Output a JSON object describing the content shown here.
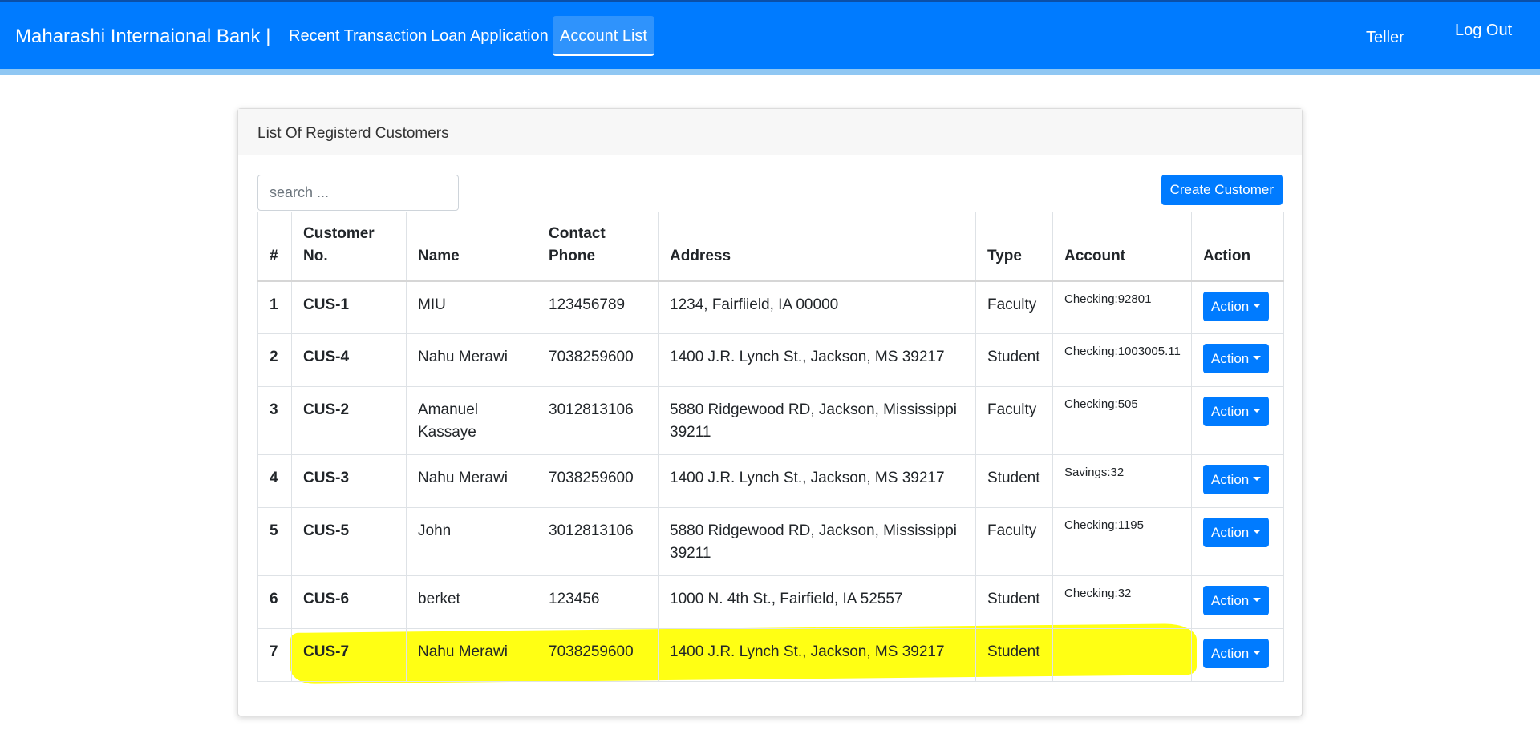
{
  "nav": {
    "brand": "Maharashi Internaional Bank |",
    "links": [
      "Recent Transaction",
      "Loan Application",
      "Account List"
    ],
    "role": "Teller",
    "logout": "Log Out"
  },
  "card": {
    "title": "List Of Registerd Customers",
    "search_placeholder": "search ...",
    "create_label": "Create Customer"
  },
  "table": {
    "headers": {
      "num": "#",
      "customer_no_1": "Customer",
      "customer_no_2": "No.",
      "name": "Name",
      "phone_1": "Contact",
      "phone_2": "Phone",
      "address": "Address",
      "type": "Type",
      "account": "Account",
      "action": "Action"
    },
    "rows": [
      {
        "num": "1",
        "id": "CUS-1",
        "name": "MIU",
        "phone": "123456789",
        "address": "1234, Fairfiield, IA 00000",
        "type": "Faculty",
        "account": "Checking:92801",
        "action": "Action"
      },
      {
        "num": "2",
        "id": "CUS-4",
        "name": "Nahu Merawi",
        "phone": "7038259600",
        "address": "1400 J.R. Lynch St., Jackson, MS 39217",
        "type": "Student",
        "account": "Checking:1003005.11",
        "action": "Action"
      },
      {
        "num": "3",
        "id": "CUS-2",
        "name": "Amanuel Kassaye",
        "phone": "3012813106",
        "address": "5880 Ridgewood RD, Jackson, Mississippi 39211",
        "type": "Faculty",
        "account": "Checking:505",
        "action": "Action"
      },
      {
        "num": "4",
        "id": "CUS-3",
        "name": "Nahu Merawi",
        "phone": "7038259600",
        "address": "1400 J.R. Lynch St., Jackson, MS 39217",
        "type": "Student",
        "account": "Savings:32",
        "action": "Action"
      },
      {
        "num": "5",
        "id": "CUS-5",
        "name": "John",
        "phone": "3012813106",
        "address": "5880 Ridgewood RD, Jackson, Mississippi 39211",
        "type": "Faculty",
        "account": "Checking:1195",
        "action": "Action"
      },
      {
        "num": "6",
        "id": "CUS-6",
        "name": "berket",
        "phone": "123456",
        "address": "1000 N. 4th St., Fairfield, IA 52557",
        "type": "Student",
        "account": "Checking:32",
        "action": "Action"
      },
      {
        "num": "7",
        "id": "CUS-7",
        "name": "Nahu Merawi",
        "phone": "7038259600",
        "address": "1400 J.R. Lynch St., Jackson, MS 39217",
        "type": "Student",
        "account": "",
        "action": "Action"
      }
    ]
  },
  "colors": {
    "primary": "#007bff",
    "highlight": "#ffff00"
  }
}
